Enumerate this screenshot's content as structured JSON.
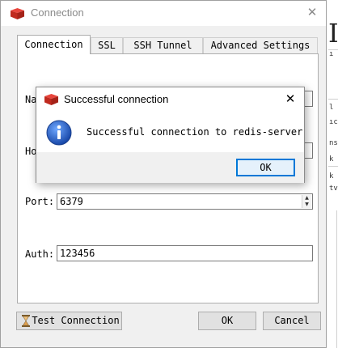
{
  "window": {
    "title": "Connection",
    "close_glyph": "✕",
    "icon": "redis-logo-icon"
  },
  "tabs": [
    {
      "label": "Connection",
      "active": true
    },
    {
      "label": "SSL",
      "active": false
    },
    {
      "label": "SSH Tunnel",
      "active": false
    },
    {
      "label": "Advanced Settings",
      "active": false
    }
  ],
  "form": {
    "name_label": "Na",
    "host_label": "Ho",
    "port_label": "Port:",
    "port_value": "6379",
    "auth_label": "Auth:",
    "auth_value": "123456"
  },
  "buttons": {
    "test_connection": "Test Connection",
    "ok": "OK",
    "cancel": "Cancel"
  },
  "dialog": {
    "title": "Successful connection",
    "message": "Successful connection to redis-server",
    "ok": "OK",
    "close_glyph": "✕",
    "icon": "info-icon"
  },
  "background": {
    "fragments": [
      "I",
      "ı",
      "l",
      "ıc",
      "ns",
      "k",
      "tv"
    ]
  },
  "colors": {
    "redis_red": "#d82c20",
    "info_blue": "#1f5fc6",
    "focus_blue": "#0078d7"
  }
}
